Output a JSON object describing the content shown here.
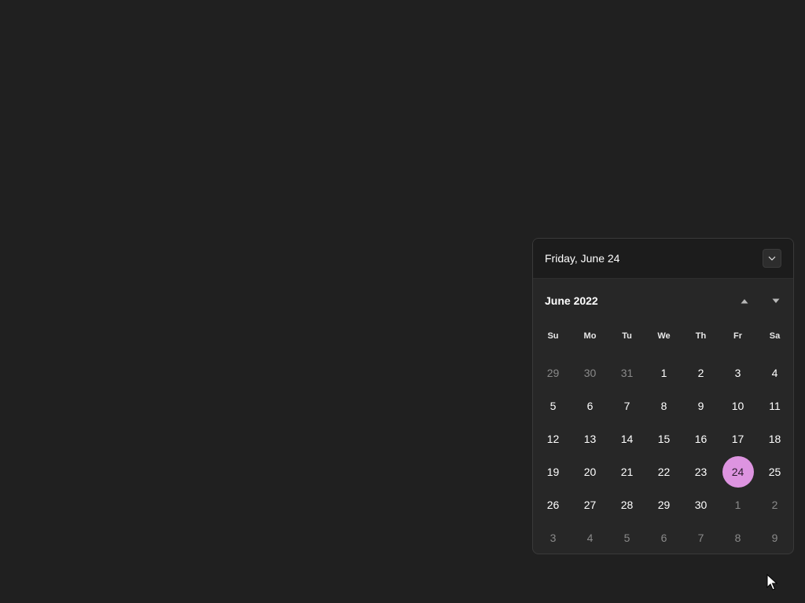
{
  "flyout": {
    "header_date": "Friday, June 24",
    "month_title": "June 2022",
    "weekdays": [
      "Su",
      "Mo",
      "Tu",
      "We",
      "Th",
      "Fr",
      "Sa"
    ],
    "days": [
      {
        "label": "29",
        "current_month": false
      },
      {
        "label": "30",
        "current_month": false
      },
      {
        "label": "31",
        "current_month": false
      },
      {
        "label": "1",
        "current_month": true
      },
      {
        "label": "2",
        "current_month": true
      },
      {
        "label": "3",
        "current_month": true
      },
      {
        "label": "4",
        "current_month": true
      },
      {
        "label": "5",
        "current_month": true
      },
      {
        "label": "6",
        "current_month": true
      },
      {
        "label": "7",
        "current_month": true
      },
      {
        "label": "8",
        "current_month": true
      },
      {
        "label": "9",
        "current_month": true
      },
      {
        "label": "10",
        "current_month": true
      },
      {
        "label": "11",
        "current_month": true
      },
      {
        "label": "12",
        "current_month": true
      },
      {
        "label": "13",
        "current_month": true
      },
      {
        "label": "14",
        "current_month": true
      },
      {
        "label": "15",
        "current_month": true
      },
      {
        "label": "16",
        "current_month": true
      },
      {
        "label": "17",
        "current_month": true
      },
      {
        "label": "18",
        "current_month": true
      },
      {
        "label": "19",
        "current_month": true
      },
      {
        "label": "20",
        "current_month": true
      },
      {
        "label": "21",
        "current_month": true
      },
      {
        "label": "22",
        "current_month": true
      },
      {
        "label": "23",
        "current_month": true
      },
      {
        "label": "24",
        "current_month": true,
        "today": true
      },
      {
        "label": "25",
        "current_month": true
      },
      {
        "label": "26",
        "current_month": true
      },
      {
        "label": "27",
        "current_month": true
      },
      {
        "label": "28",
        "current_month": true
      },
      {
        "label": "29",
        "current_month": true
      },
      {
        "label": "30",
        "current_month": true
      },
      {
        "label": "1",
        "current_month": false
      },
      {
        "label": "2",
        "current_month": false
      },
      {
        "label": "3",
        "current_month": false
      },
      {
        "label": "4",
        "current_month": false
      },
      {
        "label": "5",
        "current_month": false
      },
      {
        "label": "6",
        "current_month": false
      },
      {
        "label": "7",
        "current_month": false
      },
      {
        "label": "8",
        "current_month": false
      },
      {
        "label": "9",
        "current_month": false
      }
    ]
  },
  "icons": {
    "collapse": "chevron-down-icon",
    "prev_month": "caret-up-icon",
    "next_month": "caret-down-icon",
    "pointer": "mouse-pointer-icon"
  },
  "colors": {
    "desktop_bg": "#202020",
    "flyout_bg": "#272727",
    "header_bg": "#1c1c1c",
    "today_accent": "#dd94e0",
    "text_primary": "#ffffff",
    "text_muted": "#8a8a8a"
  }
}
